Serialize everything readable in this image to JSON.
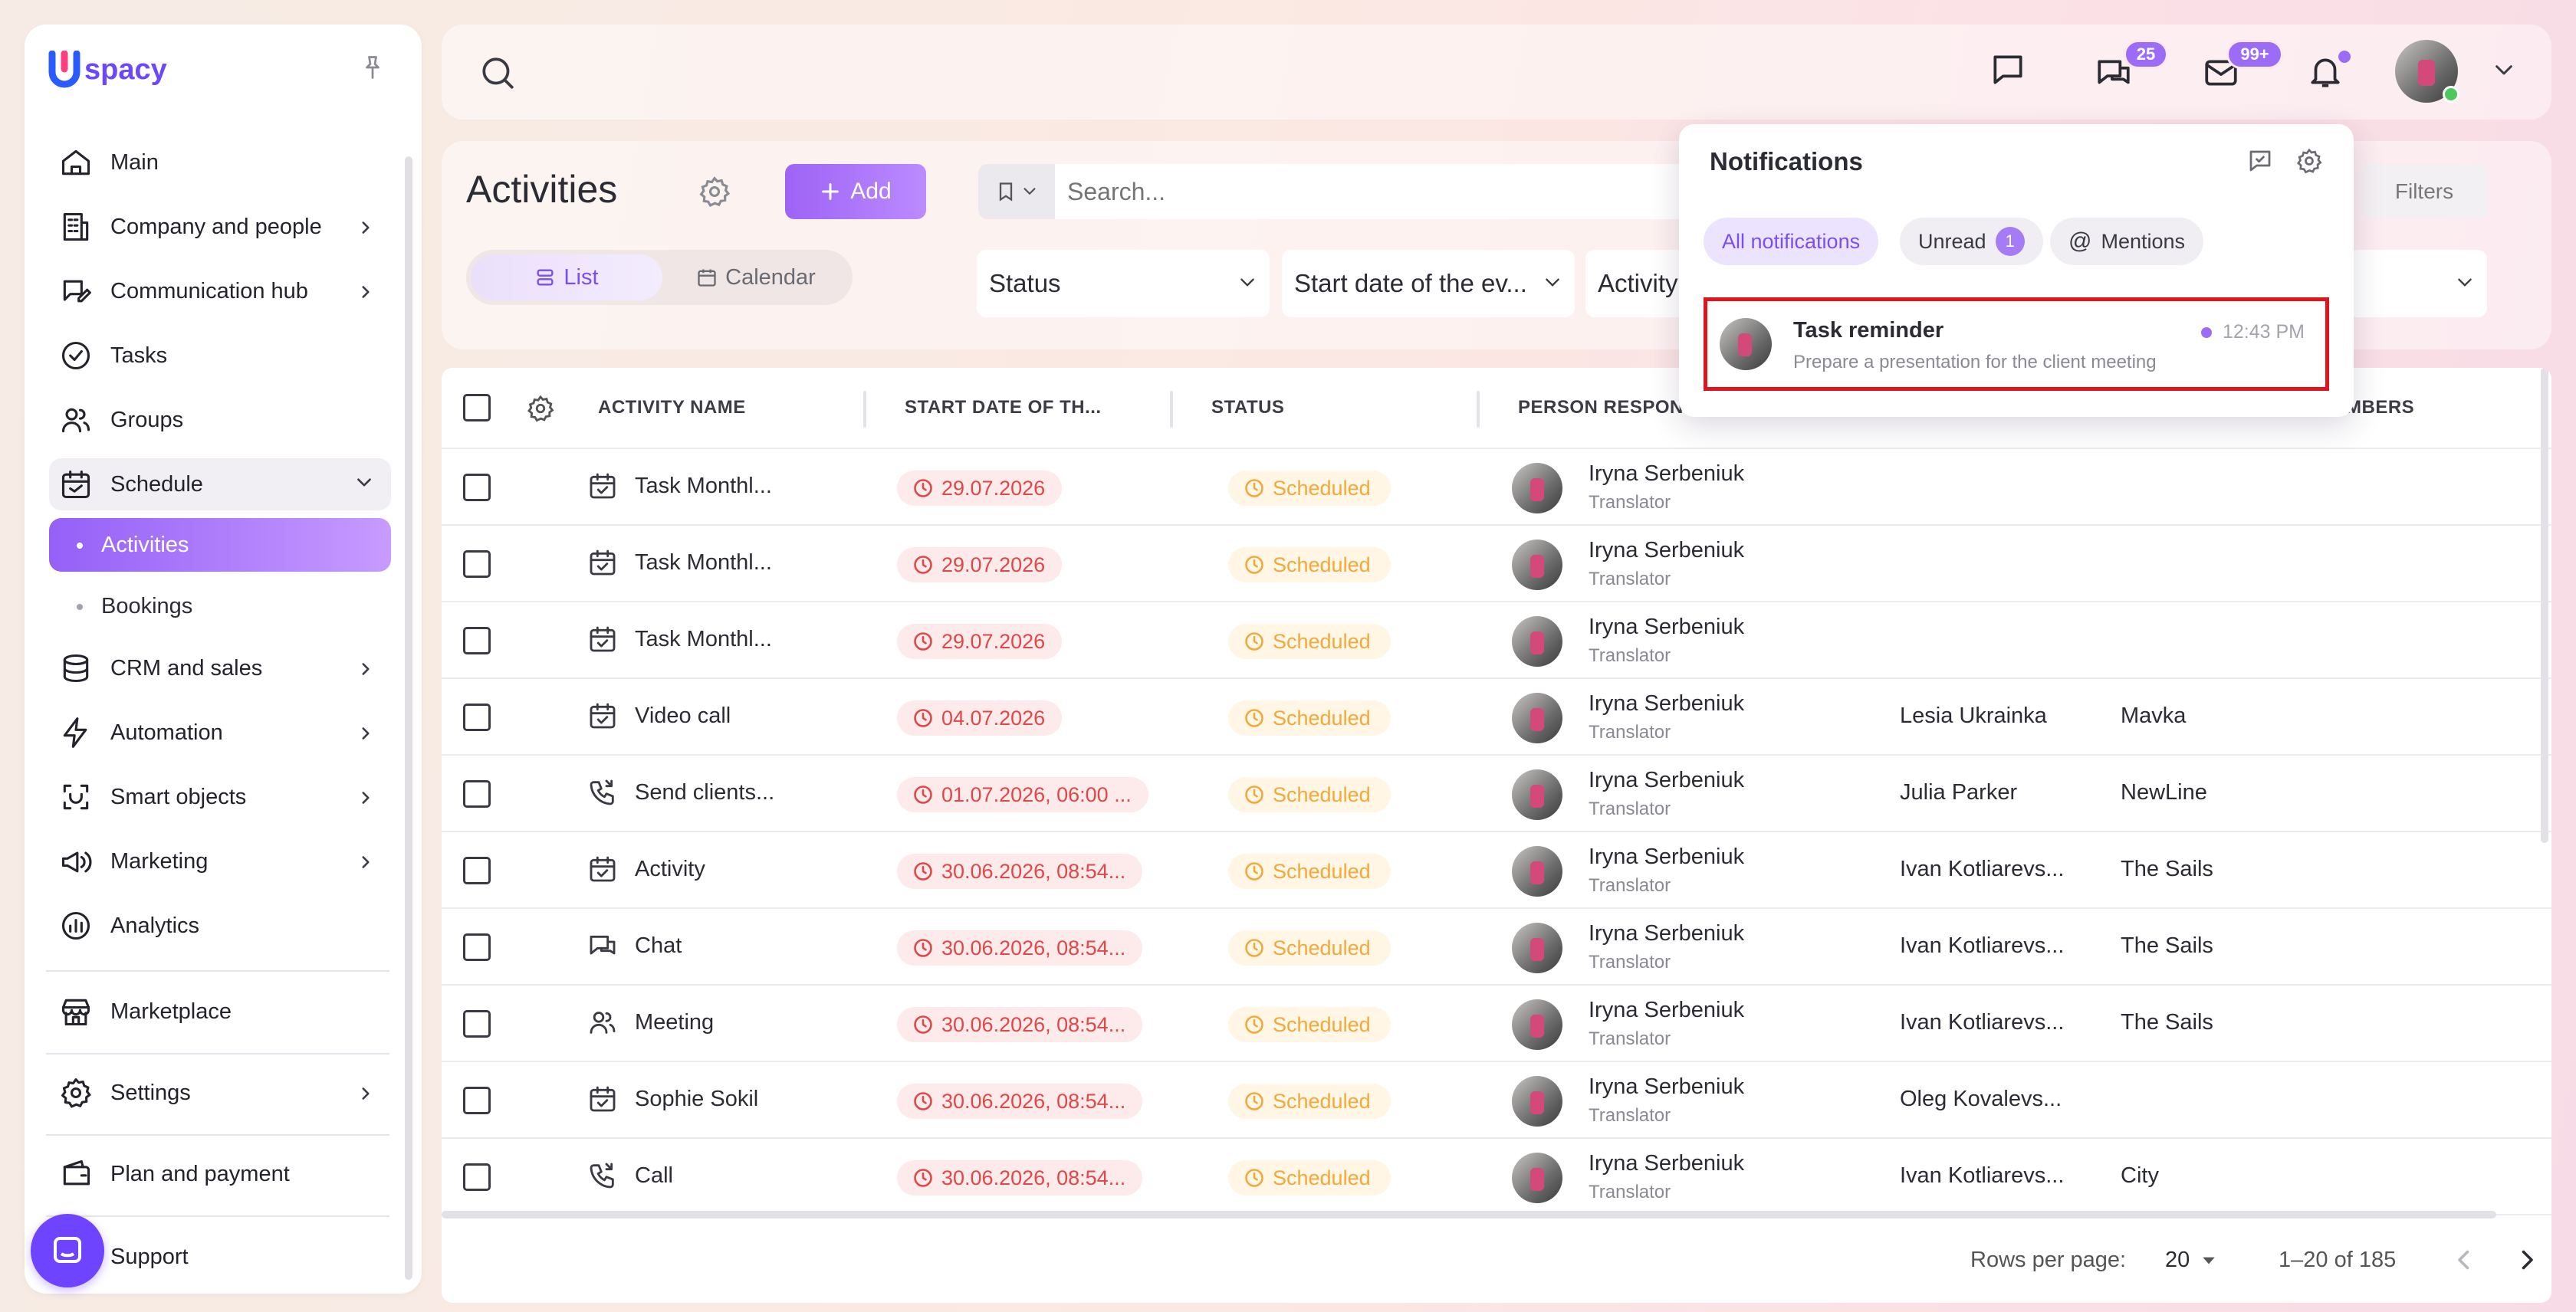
{
  "app": {
    "logo_letter": "U",
    "logo_text": "spacy"
  },
  "sidebar": {
    "items": [
      {
        "label": "Main",
        "icon": "home-icon"
      },
      {
        "label": "Company and people",
        "icon": "building-icon"
      },
      {
        "label": "Communication hub",
        "icon": "chat-edit-icon"
      },
      {
        "label": "Tasks",
        "icon": "check-circle-icon"
      },
      {
        "label": "Groups",
        "icon": "people-icon"
      },
      {
        "label": "Schedule",
        "icon": "calendar-icon"
      },
      {
        "label": "CRM and sales",
        "icon": "database-icon"
      },
      {
        "label": "Automation",
        "icon": "lightning-icon"
      },
      {
        "label": "Smart objects",
        "icon": "scan-icon"
      },
      {
        "label": "Marketing",
        "icon": "megaphone-icon"
      },
      {
        "label": "Analytics",
        "icon": "chart-icon"
      },
      {
        "label": "Marketplace",
        "icon": "store-icon"
      },
      {
        "label": "Settings",
        "icon": "gear-icon"
      },
      {
        "label": "Plan and payment",
        "icon": "wallet-icon"
      },
      {
        "label": "Support",
        "icon": "chat-bubble-icon"
      }
    ],
    "schedule_sub": [
      {
        "label": "Activities"
      },
      {
        "label": "Bookings"
      }
    ]
  },
  "topbar": {
    "chats_badge": "25",
    "mail_badge": "99+"
  },
  "page": {
    "title": "Activities",
    "add_label": "Add",
    "view_list": "List",
    "view_calendar": "Calendar",
    "search_placeholder": "Search...",
    "filters_label": "Filters",
    "filter_status": "Status",
    "filter_start_date": "Start date of the ev...",
    "filter_activity": "Activity"
  },
  "table": {
    "headers": {
      "activity_name": "ACTIVITY NAME",
      "start_date": "START DATE OF TH...",
      "status": "STATUS",
      "person": "PERSON RESPONS",
      "members": "MBERS"
    },
    "rows": [
      {
        "name": "Task Monthl...",
        "icon": "calendar-check-icon",
        "date": "29.07.2026",
        "status": "Scheduled",
        "person": "Iryna Serbeniuk",
        "role": "Translator",
        "contact": "",
        "company": ""
      },
      {
        "name": "Task Monthl...",
        "icon": "calendar-check-icon",
        "date": "29.07.2026",
        "status": "Scheduled",
        "person": "Iryna Serbeniuk",
        "role": "Translator",
        "contact": "",
        "company": ""
      },
      {
        "name": "Task Monthl...",
        "icon": "calendar-check-icon",
        "date": "29.07.2026",
        "status": "Scheduled",
        "person": "Iryna Serbeniuk",
        "role": "Translator",
        "contact": "",
        "company": ""
      },
      {
        "name": "Video call",
        "icon": "calendar-check-icon",
        "date": "04.07.2026",
        "status": "Scheduled",
        "person": "Iryna Serbeniuk",
        "role": "Translator",
        "contact": "Lesia Ukrainka",
        "company": "Mavka"
      },
      {
        "name": "Send clients...",
        "icon": "phone-icon",
        "date": "01.07.2026, 06:00 ...",
        "status": "Scheduled",
        "person": "Iryna Serbeniuk",
        "role": "Translator",
        "contact": "Julia Parker",
        "company": "NewLine"
      },
      {
        "name": "Activity",
        "icon": "calendar-check-icon",
        "date": "30.06.2026, 08:54...",
        "status": "Scheduled",
        "person": "Iryna Serbeniuk",
        "role": "Translator",
        "contact": "Ivan Kotliarevs...",
        "company": "The Sails"
      },
      {
        "name": "Chat",
        "icon": "chat-icon",
        "date": "30.06.2026, 08:54...",
        "status": "Scheduled",
        "person": "Iryna Serbeniuk",
        "role": "Translator",
        "contact": "Ivan Kotliarevs...",
        "company": "The Sails"
      },
      {
        "name": "Meeting",
        "icon": "people-icon",
        "date": "30.06.2026, 08:54...",
        "status": "Scheduled",
        "person": "Iryna Serbeniuk",
        "role": "Translator",
        "contact": "Ivan Kotliarevs...",
        "company": "The Sails"
      },
      {
        "name": "Sophie Sokil",
        "icon": "calendar-check-icon",
        "date": "30.06.2026, 08:54...",
        "status": "Scheduled",
        "person": "Iryna Serbeniuk",
        "role": "Translator",
        "contact": "Oleg Kovalevs...",
        "company": ""
      },
      {
        "name": "Call",
        "icon": "phone-icon",
        "date": "30.06.2026, 08:54...",
        "status": "Scheduled",
        "person": "Iryna Serbeniuk",
        "role": "Translator",
        "contact": "Ivan Kotliarevs...",
        "company": "City"
      }
    ],
    "footer": {
      "rows_per_page_label": "Rows per page:",
      "rows_per_page": "20",
      "range": "1–20 of 185"
    }
  },
  "notifications": {
    "title": "Notifications",
    "tabs": {
      "all": "All notifications",
      "unread": "Unread",
      "unread_count": "1",
      "mentions": "Mentions"
    },
    "item": {
      "title": "Task reminder",
      "time": "12:43 PM",
      "text": "Prepare a presentation for the client meeting"
    }
  },
  "colors": {
    "accent": "#9d6cf6",
    "date_red": "#e04848",
    "status_orange": "#f2a93b",
    "highlight": "#e0141c"
  }
}
